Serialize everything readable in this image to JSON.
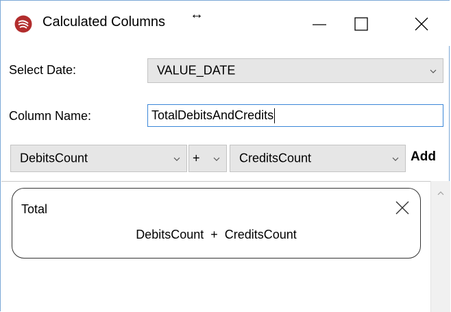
{
  "window": {
    "title": "Calculated Columns",
    "resize_glyph": "↔"
  },
  "form": {
    "select_date_label": "Select Date:",
    "select_date_value": "VALUE_DATE",
    "column_name_label": "Column Name:",
    "column_name_value": "TotalDebitsAndCredits",
    "left_operand": "DebitsCount",
    "operator": "+",
    "right_operand": "CreditsCount",
    "add_label": "Add"
  },
  "columns": [
    {
      "title": "Total",
      "expression": "DebitsCount  +  CreditsCount"
    }
  ],
  "colors": {
    "app_icon": "#b22d2d",
    "focus_border": "#3a86d8",
    "combo_bg": "#e6e6e6"
  },
  "icons": [
    "app-logo-icon",
    "minimize-icon",
    "maximize-icon",
    "close-icon",
    "chevron-down-icon",
    "scroll-up-icon"
  ]
}
